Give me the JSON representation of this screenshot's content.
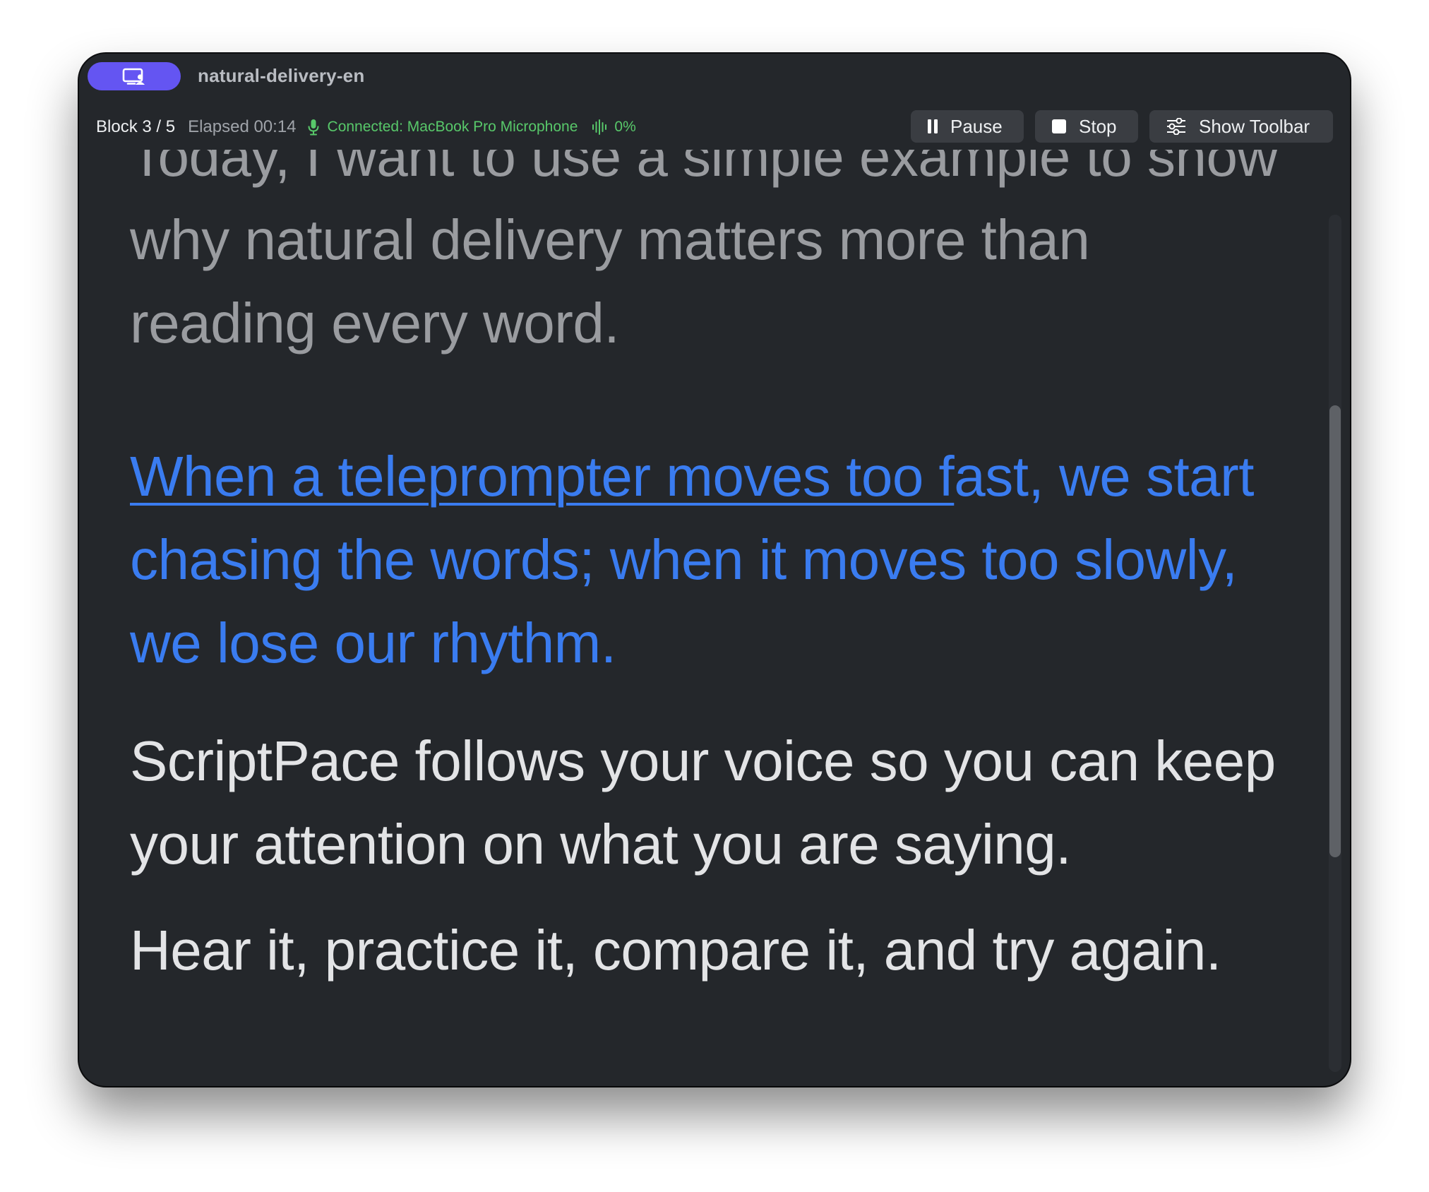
{
  "window": {
    "document_title": "natural-delivery-en"
  },
  "status": {
    "block": "Block 3 / 5",
    "elapsed": "Elapsed 00:14",
    "connection": "Connected: MacBook Pro Microphone",
    "input_level": "0%"
  },
  "toolbar": {
    "pause_label": "Pause",
    "stop_label": "Stop",
    "show_toolbar_label": "Show Toolbar"
  },
  "script": {
    "past": "Today, I want to use a simple example to show why natural delivery matters more than reading every word.",
    "current_read": "When a teleprompter moves too f",
    "current_rest": "ast, we start chasing the words; when it moves too slowly, we lose our rhythm.",
    "next": [
      "ScriptPace follows your voice so you can keep your attention on what you are saying.",
      "Hear it, practice it, compare it, and try again."
    ]
  },
  "icons": {
    "app": "teleprompter-display-icon",
    "mic": "microphone-icon",
    "level": "audio-waveform-icon",
    "pause": "pause-icon",
    "stop": "stop-icon",
    "toolbar": "sliders-icon"
  },
  "colors": {
    "accent": "#6455f2",
    "current_text": "#3a7cf0",
    "connected": "#58c86a",
    "background": "#24272b"
  }
}
